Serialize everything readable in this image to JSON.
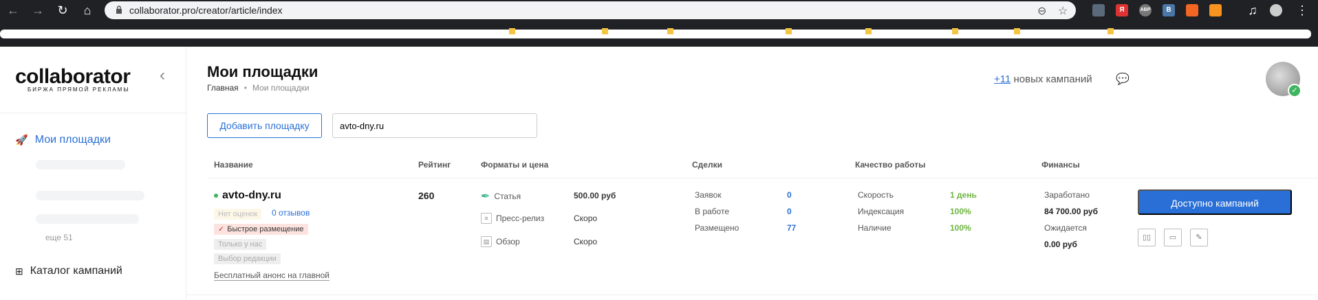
{
  "browser": {
    "url": "collaborator.pro/creator/article/index",
    "extensions": [
      {
        "icon": "ext-monitor-icon",
        "text": "",
        "color": "#5a6a7a"
      },
      {
        "icon": "ext-yandex-icon",
        "text": "Я",
        "color": "#d33"
      },
      {
        "icon": "ext-abp-icon",
        "text": "ABP",
        "color": "#777"
      },
      {
        "icon": "ext-vk-icon",
        "text": "B",
        "color": "#4a76a8"
      },
      {
        "icon": "ext-rss-icon",
        "text": "",
        "color": "#f26522"
      },
      {
        "icon": "ext-ok-icon",
        "text": "",
        "color": "#f7931e"
      }
    ]
  },
  "sidebar": {
    "logo": "collaborator",
    "logo_tagline": "БИРЖА ПРЯМОЙ РЕКЛАМЫ",
    "nav_my_sites": "Мои площадки",
    "more": "еще 51",
    "nav_catalog": "Каталог кампаний"
  },
  "header": {
    "title": "Мои площадки",
    "breadcrumb_home": "Главная",
    "breadcrumb_current": "Мои площадки",
    "new_campaigns_count": "+11",
    "new_campaigns_text": " новых кампаний"
  },
  "toolbar": {
    "add_site_label": "Добавить площадку",
    "search_value": "avto-dny.ru"
  },
  "table": {
    "headers": {
      "name": "Название",
      "rating": "Рейтинг",
      "formats": "Форматы и цена",
      "deals": "Сделки",
      "quality": "Качество работы",
      "finance": "Финансы"
    },
    "row": {
      "site": "avto-dny.ru",
      "no_ratings": "Нет оценок",
      "reviews": "0 отзывов",
      "fast_placement": "Быстрое размещение",
      "only_here": "Только у нас",
      "editors_choice": "Выбор редакции",
      "free_announce": "Бесплатный анонс на главной",
      "rating": "260",
      "formats": [
        {
          "name": "Статья",
          "price": "500.00 руб"
        },
        {
          "name": "Пресс-релиз",
          "price": "Скоро"
        },
        {
          "name": "Обзор",
          "price": "Скоро"
        }
      ],
      "deals": [
        {
          "label": "Заявок",
          "value": "0"
        },
        {
          "label": "В работе",
          "value": "0"
        },
        {
          "label": "Размещено",
          "value": "77"
        }
      ],
      "quality": [
        {
          "label": "Скорость",
          "value": "1 день"
        },
        {
          "label": "Индексация",
          "value": "100%"
        },
        {
          "label": "Наличие",
          "value": "100%"
        }
      ],
      "finance": {
        "earned_label": "Заработано",
        "earned": "84 700.00 руб",
        "expected_label": "Ожидается",
        "expected": "0.00 руб"
      },
      "campaigns_button": "Доступно кампаний"
    }
  }
}
